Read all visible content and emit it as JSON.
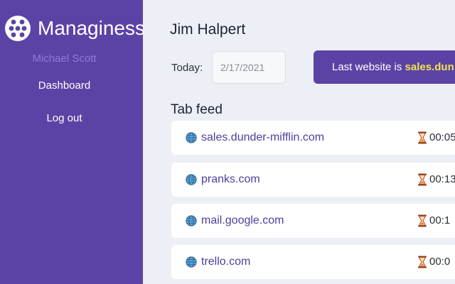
{
  "sidebar": {
    "app_title": "Managiness",
    "user_name": "Michael Scott",
    "nav": [
      {
        "label": "Dashboard"
      },
      {
        "label": "Log out"
      }
    ]
  },
  "main": {
    "title": "Jim Halpert",
    "today_label": "Today:",
    "date_value": "2/17/2021",
    "banner": {
      "prefix": "Last website is ",
      "site": "sales.dun"
    },
    "feed_title": "Tab feed",
    "feed": [
      {
        "site": "sales.dunder-mifflin.com",
        "time": "00:05"
      },
      {
        "site": "pranks.com",
        "time": "00:13"
      },
      {
        "site": "mail.google.com",
        "time": "00:1"
      },
      {
        "site": "trello.com",
        "time": "00:0"
      }
    ]
  },
  "colors": {
    "sidebar": "#5b43a6",
    "background": "#eceff5",
    "accent_highlight": "#f2e34a",
    "link": "#4e3e9a"
  },
  "icons": {
    "logo": "logo-icon",
    "site": "globe-icon",
    "duration": "hourglass-icon"
  }
}
